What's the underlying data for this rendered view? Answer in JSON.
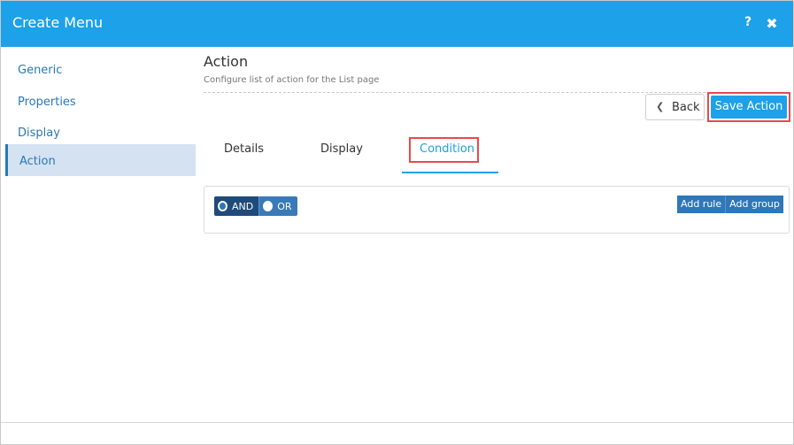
{
  "dialog": {
    "title": "Create Menu",
    "help_label": "?",
    "close_label": "✖"
  },
  "sidebar": {
    "items": [
      {
        "label": "Generic"
      },
      {
        "label": "Properties"
      },
      {
        "label": "Display"
      },
      {
        "label": "Action"
      }
    ],
    "active_index": 3
  },
  "main": {
    "title": "Action",
    "subtitle": "Configure list of action for the List page",
    "back_label": "Back",
    "back_icon": "chevron-left-icon",
    "save_label": "Save Action"
  },
  "tabs": [
    {
      "label": "Details"
    },
    {
      "label": "Display"
    },
    {
      "label": "Condition"
    }
  ],
  "active_tab": "Condition",
  "query_builder": {
    "and_label": "AND",
    "or_label": "OR",
    "selected": "AND",
    "add_rule_label": "Add rule",
    "add_group_label": "Add group"
  },
  "colors": {
    "accent": "#1da1e8",
    "highlight": "#e84a4a",
    "sidebar_active": "#d4e2f2",
    "button_dark": "#2f77b8"
  }
}
